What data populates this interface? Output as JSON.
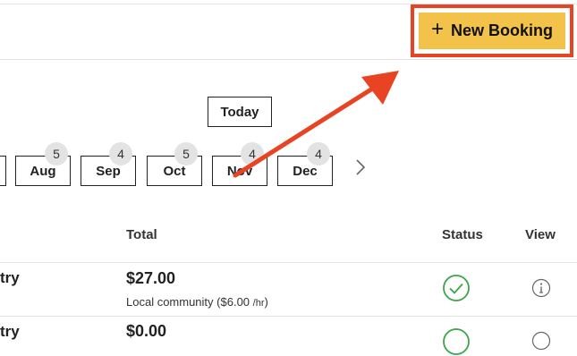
{
  "header": {
    "new_booking_label": "New Booking",
    "plus_glyph": "+",
    "accent_color": "#f2c24a",
    "highlight_color": "#e84424"
  },
  "calendar": {
    "today_label": "Today",
    "months": [
      {
        "label": "Aug",
        "count": "5"
      },
      {
        "label": "Sep",
        "count": "4"
      },
      {
        "label": "Oct",
        "count": "5"
      },
      {
        "label": "Nov",
        "count": "4"
      },
      {
        "label": "Dec",
        "count": "4"
      }
    ],
    "next_icon": "chevron-right-icon"
  },
  "table": {
    "headers": {
      "total": "Total",
      "status": "Status",
      "view": "View"
    },
    "rows": [
      {
        "name": "try",
        "total": "$27.00",
        "rate_desc": "Local community",
        "rate": "($6.00 ",
        "rate_unit": "/hr",
        "rate_close": ")",
        "status_icon": "check-circle-icon",
        "view_icon": "info-icon"
      },
      {
        "name": "try",
        "total": "$0.00",
        "status_icon": "check-circle-icon",
        "view_icon": "info-icon"
      }
    ]
  },
  "annotation": {
    "arrow_color": "#e84424"
  }
}
